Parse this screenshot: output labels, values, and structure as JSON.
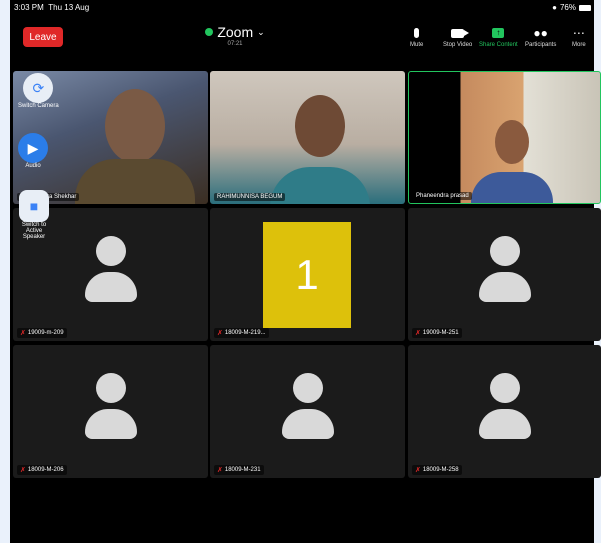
{
  "status_bar": {
    "time": "3:03 PM",
    "date": "Thu 13 Aug",
    "battery": "76%"
  },
  "header": {
    "leave_label": "Leave",
    "meeting_title": "Zoom",
    "timer": "07:21",
    "controls": {
      "mute": "Mute",
      "stop_video": "Stop Video",
      "share_content": "Share Content",
      "participants": "Participants",
      "more": "More"
    }
  },
  "floating": {
    "switch_camera": "Switch Camera",
    "audio": "Audio",
    "switch_speaker": "Switch to Active Speaker"
  },
  "tiles": [
    {
      "name": "Dr. Chandra Shekhar",
      "muted": false
    },
    {
      "name": "RAHIMUNNISA BEGUM",
      "muted": false
    },
    {
      "name": "Phaneendra prasad",
      "muted": false
    },
    {
      "name": "19009-m-209",
      "muted": true
    },
    {
      "name": "18009-M-219...",
      "muted": true
    },
    {
      "name": "19009-M-251",
      "muted": true
    },
    {
      "name": "18009-M-206",
      "muted": true
    },
    {
      "name": "18009-M-231",
      "muted": true
    },
    {
      "name": "18009-M-258",
      "muted": true
    }
  ],
  "overlay_badge": "1",
  "colors": {
    "leave": "#e02828",
    "active_green": "#22c55e",
    "badge": "#ddc10b"
  }
}
